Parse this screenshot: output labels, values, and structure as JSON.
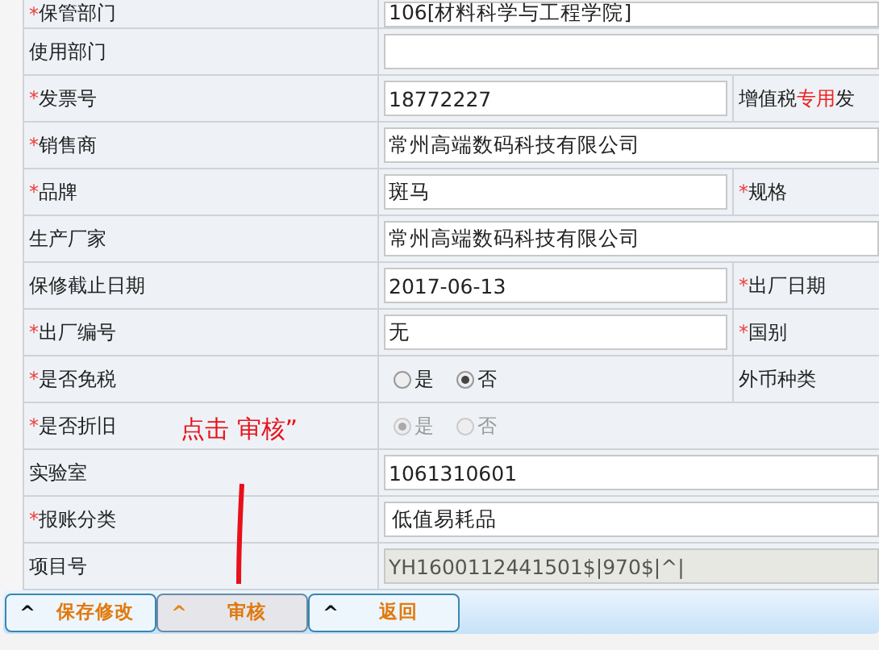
{
  "form_rows": [
    {
      "label": "保管部门",
      "mark": "*",
      "kind": "wide",
      "value": "106[材料科学与工程学院]"
    },
    {
      "label": "使用部门",
      "kind": "wide"
    },
    {
      "label": "发票号",
      "mark": "*",
      "kind": "input",
      "value": "18772227",
      "extra": [
        {
          "text": "增值税",
          "highlight": false
        },
        {
          "text": "专用",
          "highlight": true
        },
        {
          "text": "发",
          "highlight": false
        }
      ]
    },
    {
      "label": "销售商",
      "mark": "*",
      "kind": "wide",
      "value": "常州高端数码科技有限公司"
    },
    {
      "label": "品牌",
      "mark": "*",
      "kind": "input",
      "value": "斑马",
      "extra": [
        {
          "text": "规格",
          "highlight": false
        }
      ],
      "extra_mark": "*"
    },
    {
      "label": "生产厂家",
      "kind": "wide",
      "value": "常州高端数码科技有限公司"
    },
    {
      "label": "保修截止日期",
      "kind": "input",
      "value": "2017-06-13",
      "extra": [
        {
          "text": "出厂日期",
          "highlight": false
        }
      ],
      "extra_mark": "*"
    },
    {
      "label": "出厂编号",
      "mark": "*",
      "kind": "input",
      "value": "无",
      "extra": [
        {
          "text": "国别",
          "highlight": false
        }
      ],
      "extra_mark": "*"
    },
    {
      "label": "是否免税",
      "mark": "*",
      "kind": "radio",
      "options": [
        {
          "label": "是",
          "selected": false,
          "disabled": false
        },
        {
          "label": "否",
          "selected": true,
          "disabled": false
        }
      ],
      "extra": [
        {
          "text": "外币种类",
          "highlight": false
        }
      ]
    },
    {
      "label": "是否折旧",
      "mark": "*",
      "kind": "radio",
      "options": [
        {
          "label": "是",
          "selected": true,
          "disabled": true
        },
        {
          "label": "否",
          "selected": false,
          "disabled": true
        }
      ]
    },
    {
      "label": "实验室",
      "kind": "wide",
      "value": "1061310601"
    },
    {
      "label": "报账分类",
      "mark": "*",
      "kind": "select",
      "value": "低值易耗品"
    },
    {
      "label": "项目号",
      "kind": "readonly",
      "value": "YH1600112441501$|970$|^|"
    }
  ],
  "annotation": {
    "text": "点击 审核”"
  },
  "buttons": [
    {
      "caret": "^",
      "label": "保存修改",
      "selected": false
    },
    {
      "caret": "^",
      "label": "审核",
      "selected": true
    },
    {
      "caret": "^",
      "label": "返回",
      "selected": false
    }
  ]
}
